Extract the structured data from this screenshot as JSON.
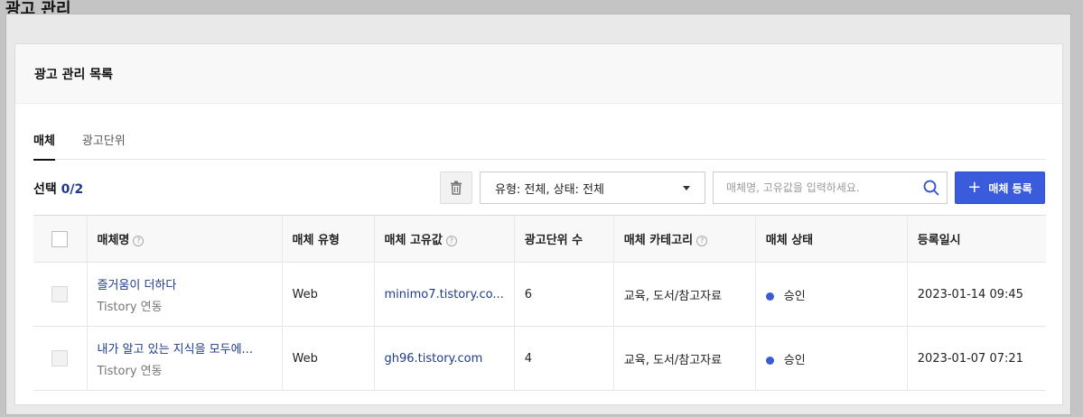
{
  "page_title": "광고 관리",
  "section_title": "광고 관리 목록",
  "tabs": [
    {
      "label": "매체",
      "active": true
    },
    {
      "label": "광고단위",
      "active": false
    }
  ],
  "toolbar": {
    "selected_label": "선택",
    "selected_count": "0/2",
    "filter_value": "유형: 전체, 상태: 전체",
    "search_placeholder": "매체명, 고유값을 입력하세요.",
    "register_label": "매체 등록"
  },
  "table": {
    "headers": [
      "매체명",
      "매체 유형",
      "매체 고유값",
      "광고단위 수",
      "매체 카테고리",
      "매체 상태",
      "등록일시"
    ],
    "help_mark": "?",
    "rows": [
      {
        "name": "즐거움이 더하다",
        "sub": "Tistory 연동",
        "type": "Web",
        "uid": "minimo7.tistory.co...",
        "ad_units": "6",
        "category": "교육, 도서/참고자료",
        "status": "승인",
        "registered": "2023-01-14 09:45"
      },
      {
        "name": "내가 알고 있는 지식을 모두에...",
        "sub": "Tistory 연동",
        "type": "Web",
        "uid": "gh96.tistory.com",
        "ad_units": "4",
        "category": "교육, 도서/참고자료",
        "status": "승인",
        "registered": "2023-01-07 07:21"
      }
    ]
  },
  "colors": {
    "accent": "#3a5bdc",
    "link": "#1e3a8a",
    "status_approved": "#3b5bd6"
  }
}
